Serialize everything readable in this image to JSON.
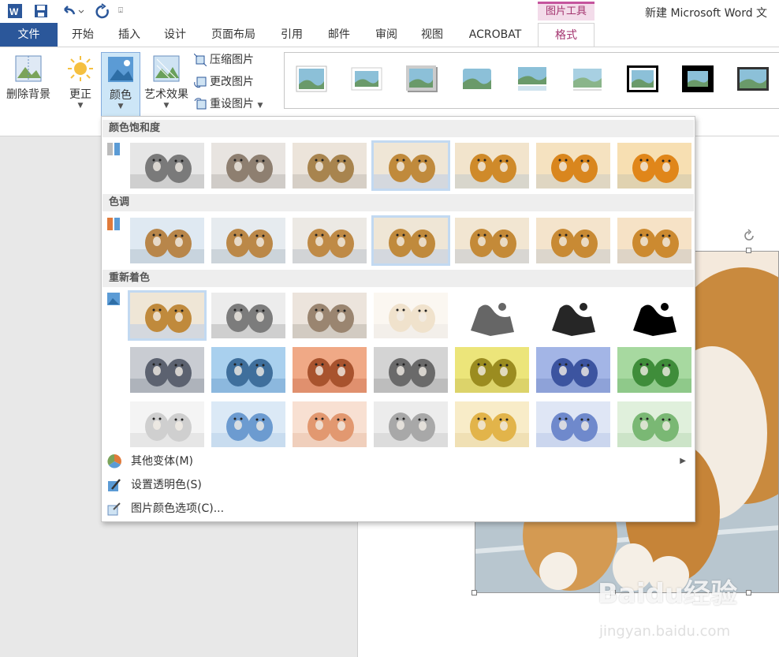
{
  "titlebar": {
    "context_tab_group": "图片工具",
    "doc_title": "新建 Microsoft Word 文"
  },
  "tabs": [
    {
      "label": "文件"
    },
    {
      "label": "开始"
    },
    {
      "label": "插入"
    },
    {
      "label": "设计"
    },
    {
      "label": "页面布局"
    },
    {
      "label": "引用"
    },
    {
      "label": "邮件"
    },
    {
      "label": "审阅"
    },
    {
      "label": "视图"
    },
    {
      "label": "ACROBAT"
    },
    {
      "label": "格式"
    }
  ],
  "ribbon": {
    "remove_bg": "删除背景",
    "corrections": "更正",
    "color": "颜色",
    "artistic": "艺术效果",
    "compress": "压缩图片",
    "change": "更改图片",
    "reset": "重设图片"
  },
  "dropdown": {
    "saturation_header": "颜色饱和度",
    "tone_header": "色调",
    "recolor_header": "重新着色",
    "more_variations": "其他变体(M)",
    "set_transparent": "设置透明色(S)",
    "color_options": "图片颜色选项(C)..."
  },
  "watermark": {
    "logo": "Baidu经验",
    "url": "jingyan.baidu.com"
  },
  "colors": {
    "file_tab": "#2b579a",
    "context_accent": "#c5549d",
    "selection": "#c2d9f1"
  }
}
